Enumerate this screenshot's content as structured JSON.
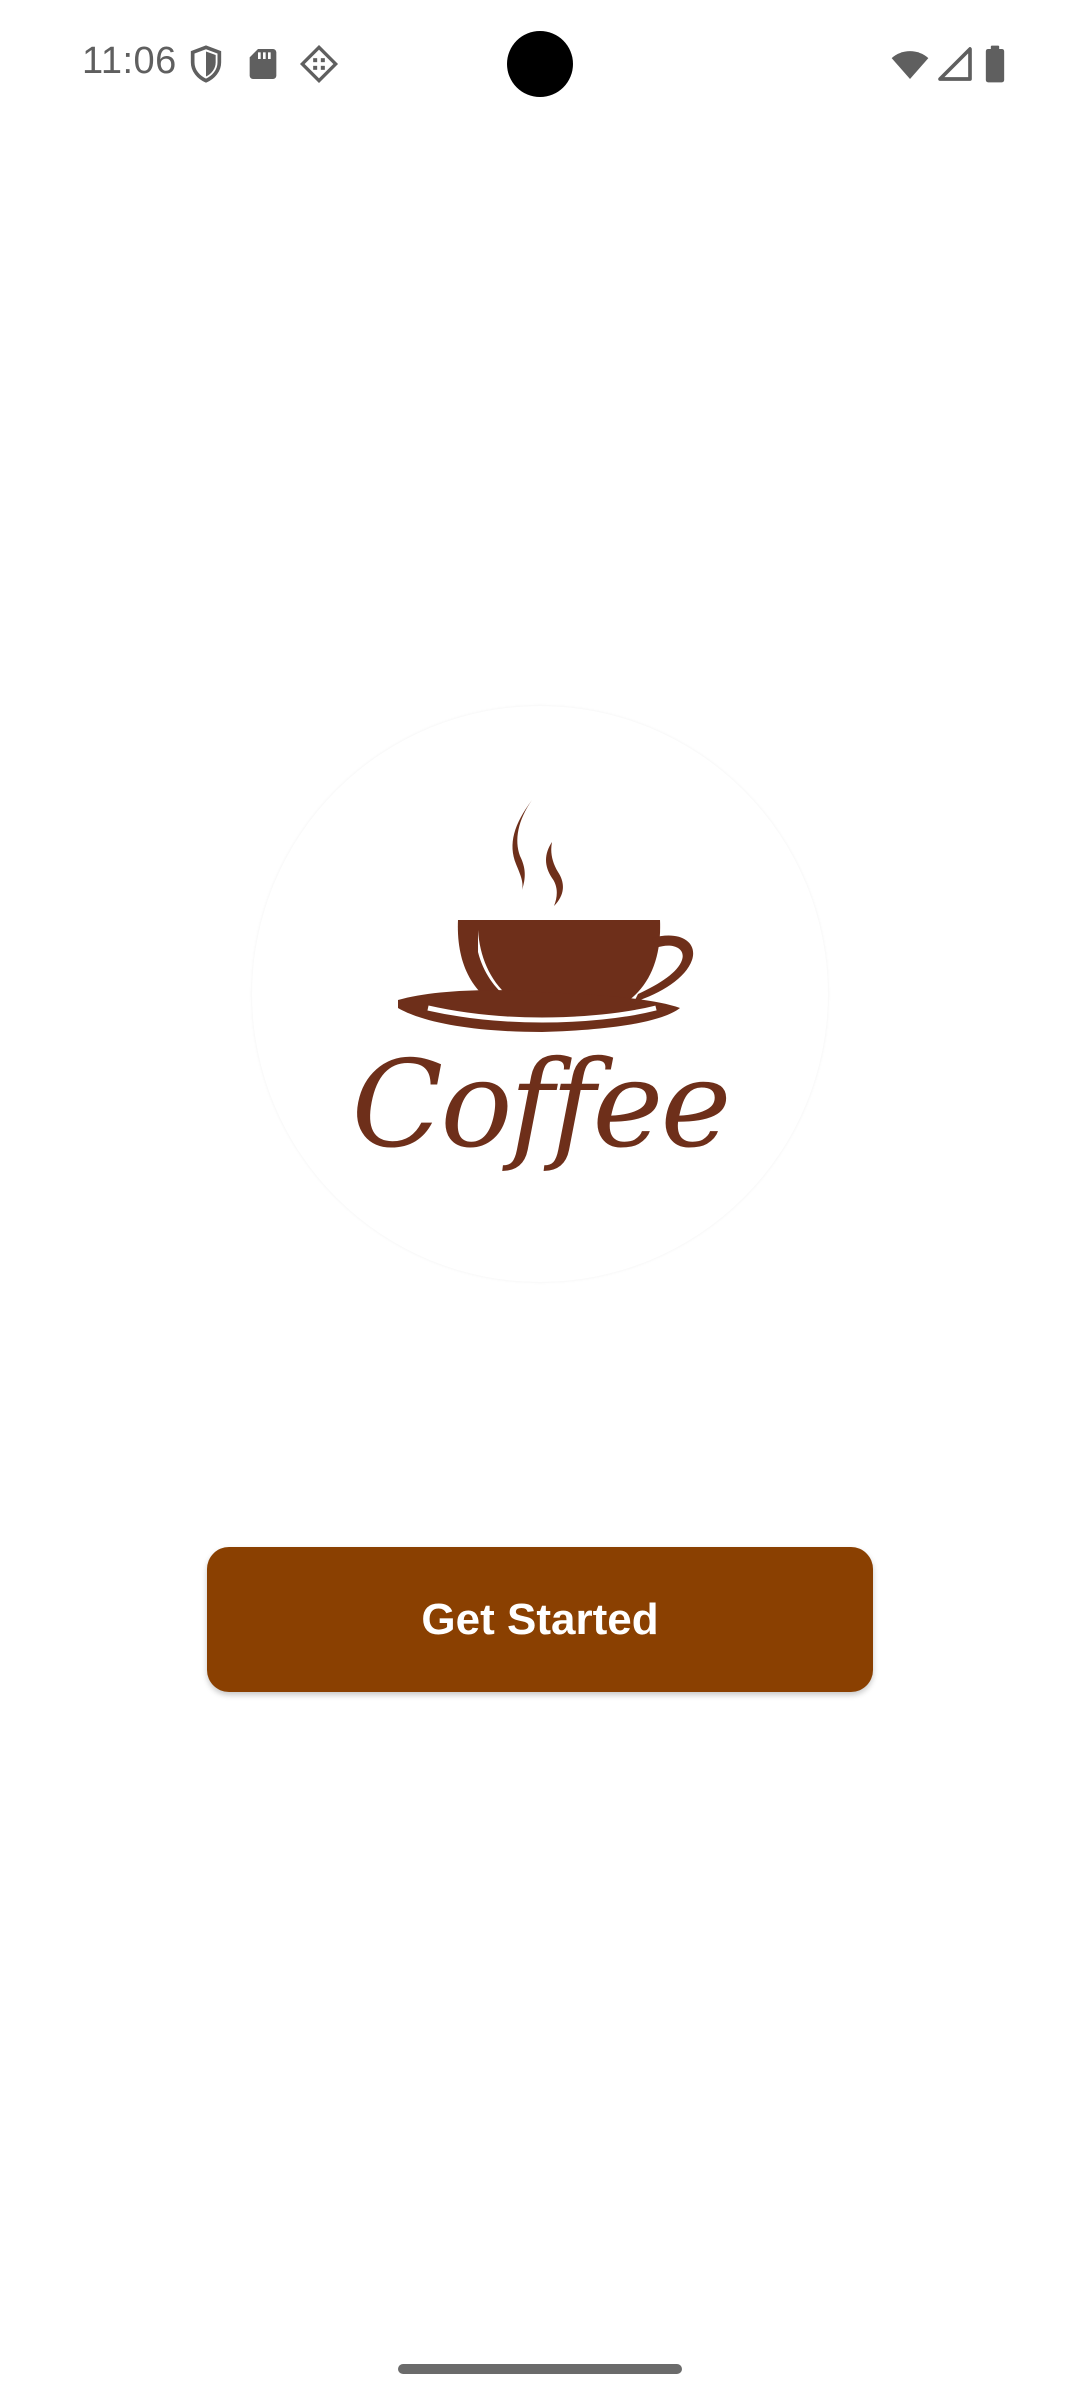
{
  "status_bar": {
    "time": "11:06",
    "left_icons": [
      "vpn-shield-icon",
      "sd-card-icon",
      "developer-debug-icon"
    ],
    "right_icons": [
      "wifi-icon",
      "cell-signal-icon",
      "battery-icon"
    ],
    "icon_color": "#5f5f5f"
  },
  "logo": {
    "wordmark": "Coffee",
    "icon": "coffee-cup-icon",
    "color": "#6e2f1a"
  },
  "actions": {
    "get_started_label": "Get Started",
    "button_color": "#8a4001"
  },
  "navigation": {
    "gesture_handle": "gesture-bar"
  }
}
